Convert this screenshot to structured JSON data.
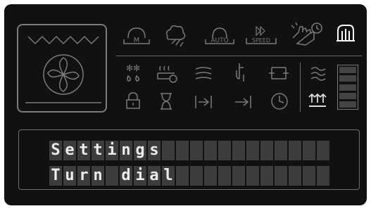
{
  "auto_label": "AUTO",
  "speed_label": "SPEED",
  "manual_label": "M",
  "display": {
    "line1": "Settings",
    "line2": "Turn dial"
  },
  "cells_per_row": 20,
  "colors": {
    "panel": "#111111",
    "icon": "#7a7a7a",
    "active_icon": "#ffffff",
    "text": "#ececec"
  }
}
